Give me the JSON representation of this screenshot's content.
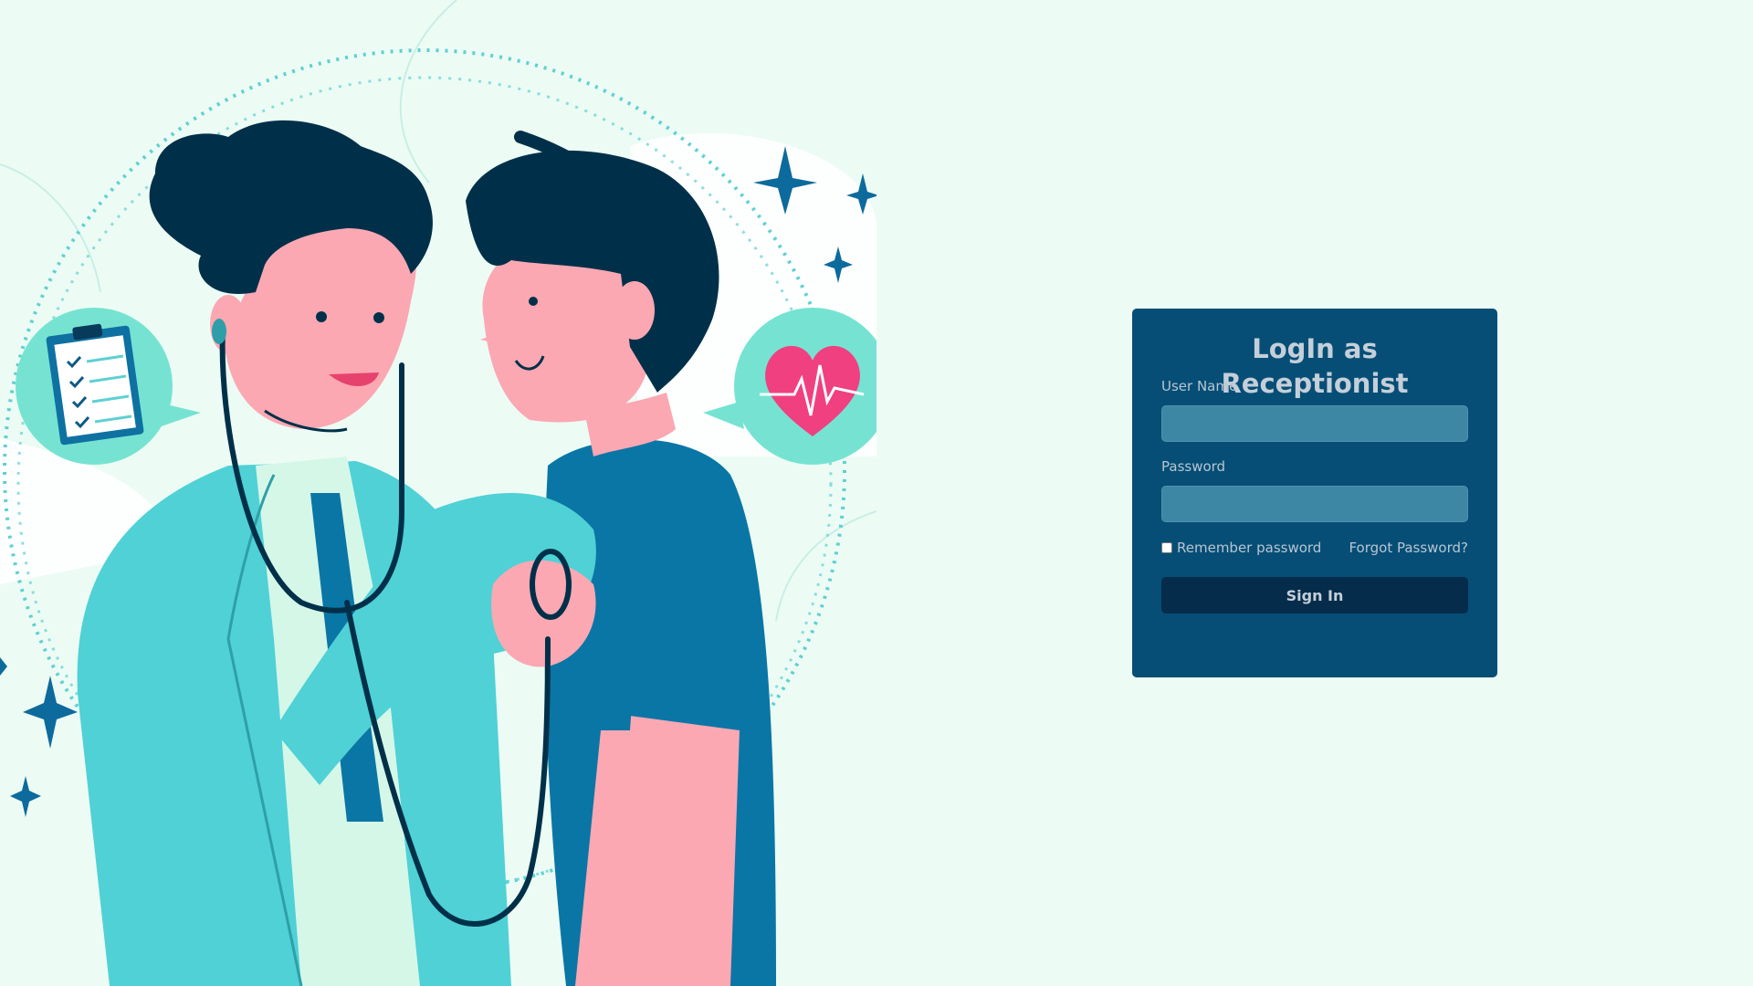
{
  "login": {
    "title": "LogIn as Receptionist",
    "username_label": "User Name",
    "username_value": "",
    "password_label": "Password",
    "password_value": "",
    "remember_label": "Remember password",
    "remember_checked": false,
    "forgot_label": "Forgot Password?",
    "signin_label": "Sign In"
  },
  "illustration": {
    "icons": [
      "clipboard-icon",
      "heart-pulse-icon",
      "sparkle-icon"
    ]
  },
  "colors": {
    "page_background": "#ecfcf4",
    "card_background": "#064e76",
    "input_background": "#3d87a4",
    "button_background": "#052c4a",
    "accent_teal": "#5fd6d3",
    "heart_pink": "#f0407f"
  }
}
